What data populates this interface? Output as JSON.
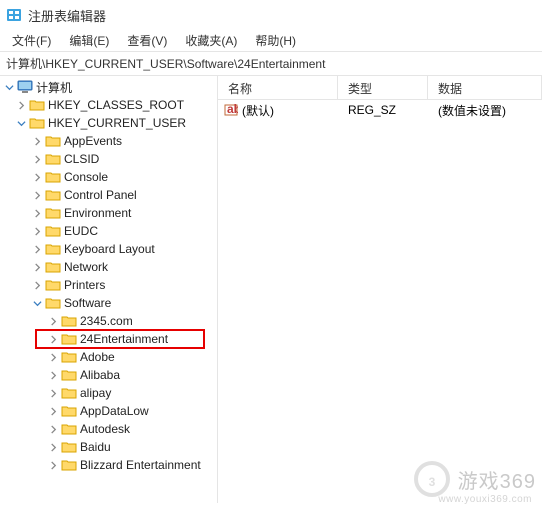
{
  "title": "注册表编辑器",
  "menu": {
    "file": "文件(F)",
    "edit": "编辑(E)",
    "view": "查看(V)",
    "fav": "收藏夹(A)",
    "help": "帮助(H)"
  },
  "address": "计算机\\HKEY_CURRENT_USER\\Software\\24Entertainment",
  "columns": {
    "name": "名称",
    "type": "类型",
    "data": "数据"
  },
  "value_row": {
    "name": "(默认)",
    "type": "REG_SZ",
    "data": "(数值未设置)"
  },
  "tree": {
    "root": "计算机",
    "hkcr": "HKEY_CLASSES_ROOT",
    "hkcu": "HKEY_CURRENT_USER",
    "hkcu_children": [
      "AppEvents",
      "CLSID",
      "Console",
      "Control Panel",
      "Environment",
      "EUDC",
      "Keyboard Layout",
      "Network",
      "Printers",
      "Software"
    ],
    "software_children": [
      "2345.com",
      "24Entertainment",
      "Adobe",
      "Alibaba",
      "alipay",
      "AppDataLow",
      "Autodesk",
      "Baidu",
      "Blizzard Entertainment"
    ]
  },
  "watermark": {
    "text": "游戏369",
    "url": "www.youxi369.com"
  }
}
